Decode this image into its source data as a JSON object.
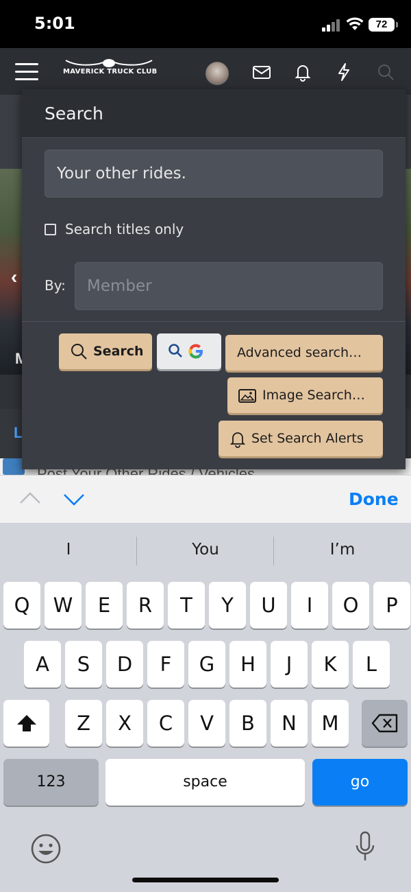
{
  "status_bar": {
    "time": "5:01",
    "battery": "72"
  },
  "header": {
    "logo_text": "MAVERICK TRUCK CLUB"
  },
  "background": {
    "list_item_text": "Post Your Other Rides / Vehicles",
    "tab_mark": "L",
    "photo_mark": "M"
  },
  "search_panel": {
    "title": "Search",
    "query_value": "Your other rides.",
    "titles_only_label": "Search titles only",
    "titles_only_checked": false,
    "by_label": "By:",
    "member_placeholder": "Member",
    "buttons": {
      "search": "Search",
      "advanced": "Advanced search…",
      "image": "Image Search…",
      "alerts": "Set Search Alerts"
    }
  },
  "accessory": {
    "done": "Done"
  },
  "keyboard": {
    "suggestions": [
      "I",
      "You",
      "I’m"
    ],
    "row1": [
      "Q",
      "W",
      "E",
      "R",
      "T",
      "Y",
      "U",
      "I",
      "O",
      "P"
    ],
    "row2": [
      "A",
      "S",
      "D",
      "F",
      "G",
      "H",
      "J",
      "K",
      "L"
    ],
    "row3": [
      "Z",
      "X",
      "C",
      "V",
      "B",
      "N",
      "M"
    ],
    "numbers_key": "123",
    "space_key": "space",
    "go_key": "go"
  },
  "colors": {
    "accent_blue": "#0a7ff5",
    "button_tan": "#e2c49f",
    "panel_bg": "#3a3d43"
  },
  "icons": [
    "hamburger-icon",
    "mail-icon",
    "bell-icon",
    "lightning-icon",
    "search-icon",
    "google-icon",
    "image-icon",
    "emoji-icon",
    "microphone-icon",
    "shift-icon",
    "backspace-icon"
  ]
}
